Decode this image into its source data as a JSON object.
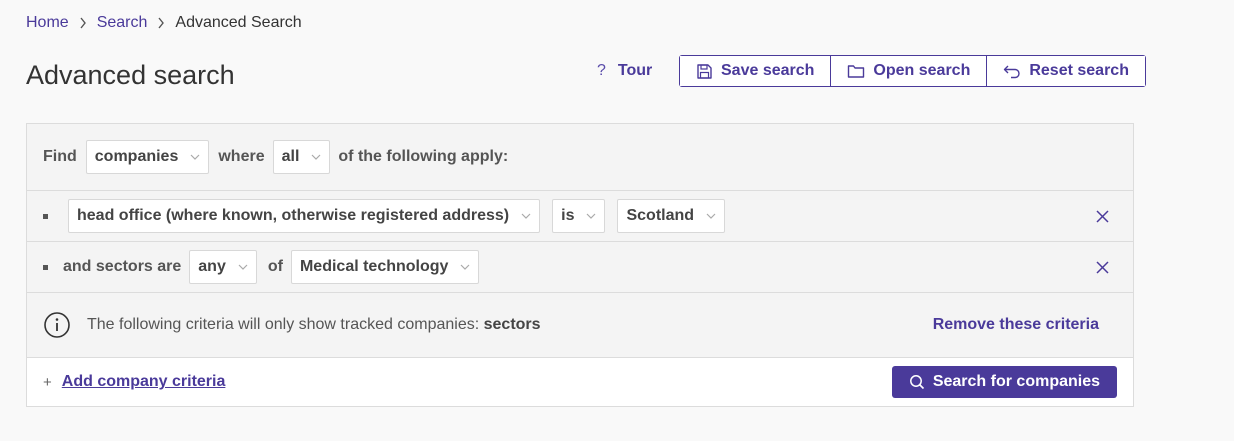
{
  "breadcrumb": {
    "home": "Home",
    "search": "Search",
    "current": "Advanced Search"
  },
  "page": {
    "title": "Advanced search"
  },
  "tour": {
    "icon": "?",
    "label": "Tour"
  },
  "toolbar": {
    "save_label": "Save search",
    "open_label": "Open search",
    "reset_label": "Reset search"
  },
  "find_row": {
    "find_label": "Find",
    "entity_value": "companies",
    "where_label": "where",
    "match_value": "all",
    "suffix_label": "of the following apply:"
  },
  "criteria": [
    {
      "field_value": "head office (where known, otherwise registered address)",
      "operator_value": "is",
      "value": "Scotland"
    },
    {
      "prefix_label": "and sectors are",
      "quantifier_value": "any",
      "of_label": "of",
      "value": "Medical technology"
    }
  ],
  "info": {
    "text": "The following criteria will only show tracked companies:",
    "highlight": "sectors",
    "remove_label": "Remove these criteria"
  },
  "footer": {
    "add_icon": "+",
    "add_label": "Add company criteria",
    "search_label": "Search for companies"
  },
  "colors": {
    "accent": "#4a3a9a",
    "background": "#f9f9f9",
    "panel": "#f4f4f4"
  }
}
